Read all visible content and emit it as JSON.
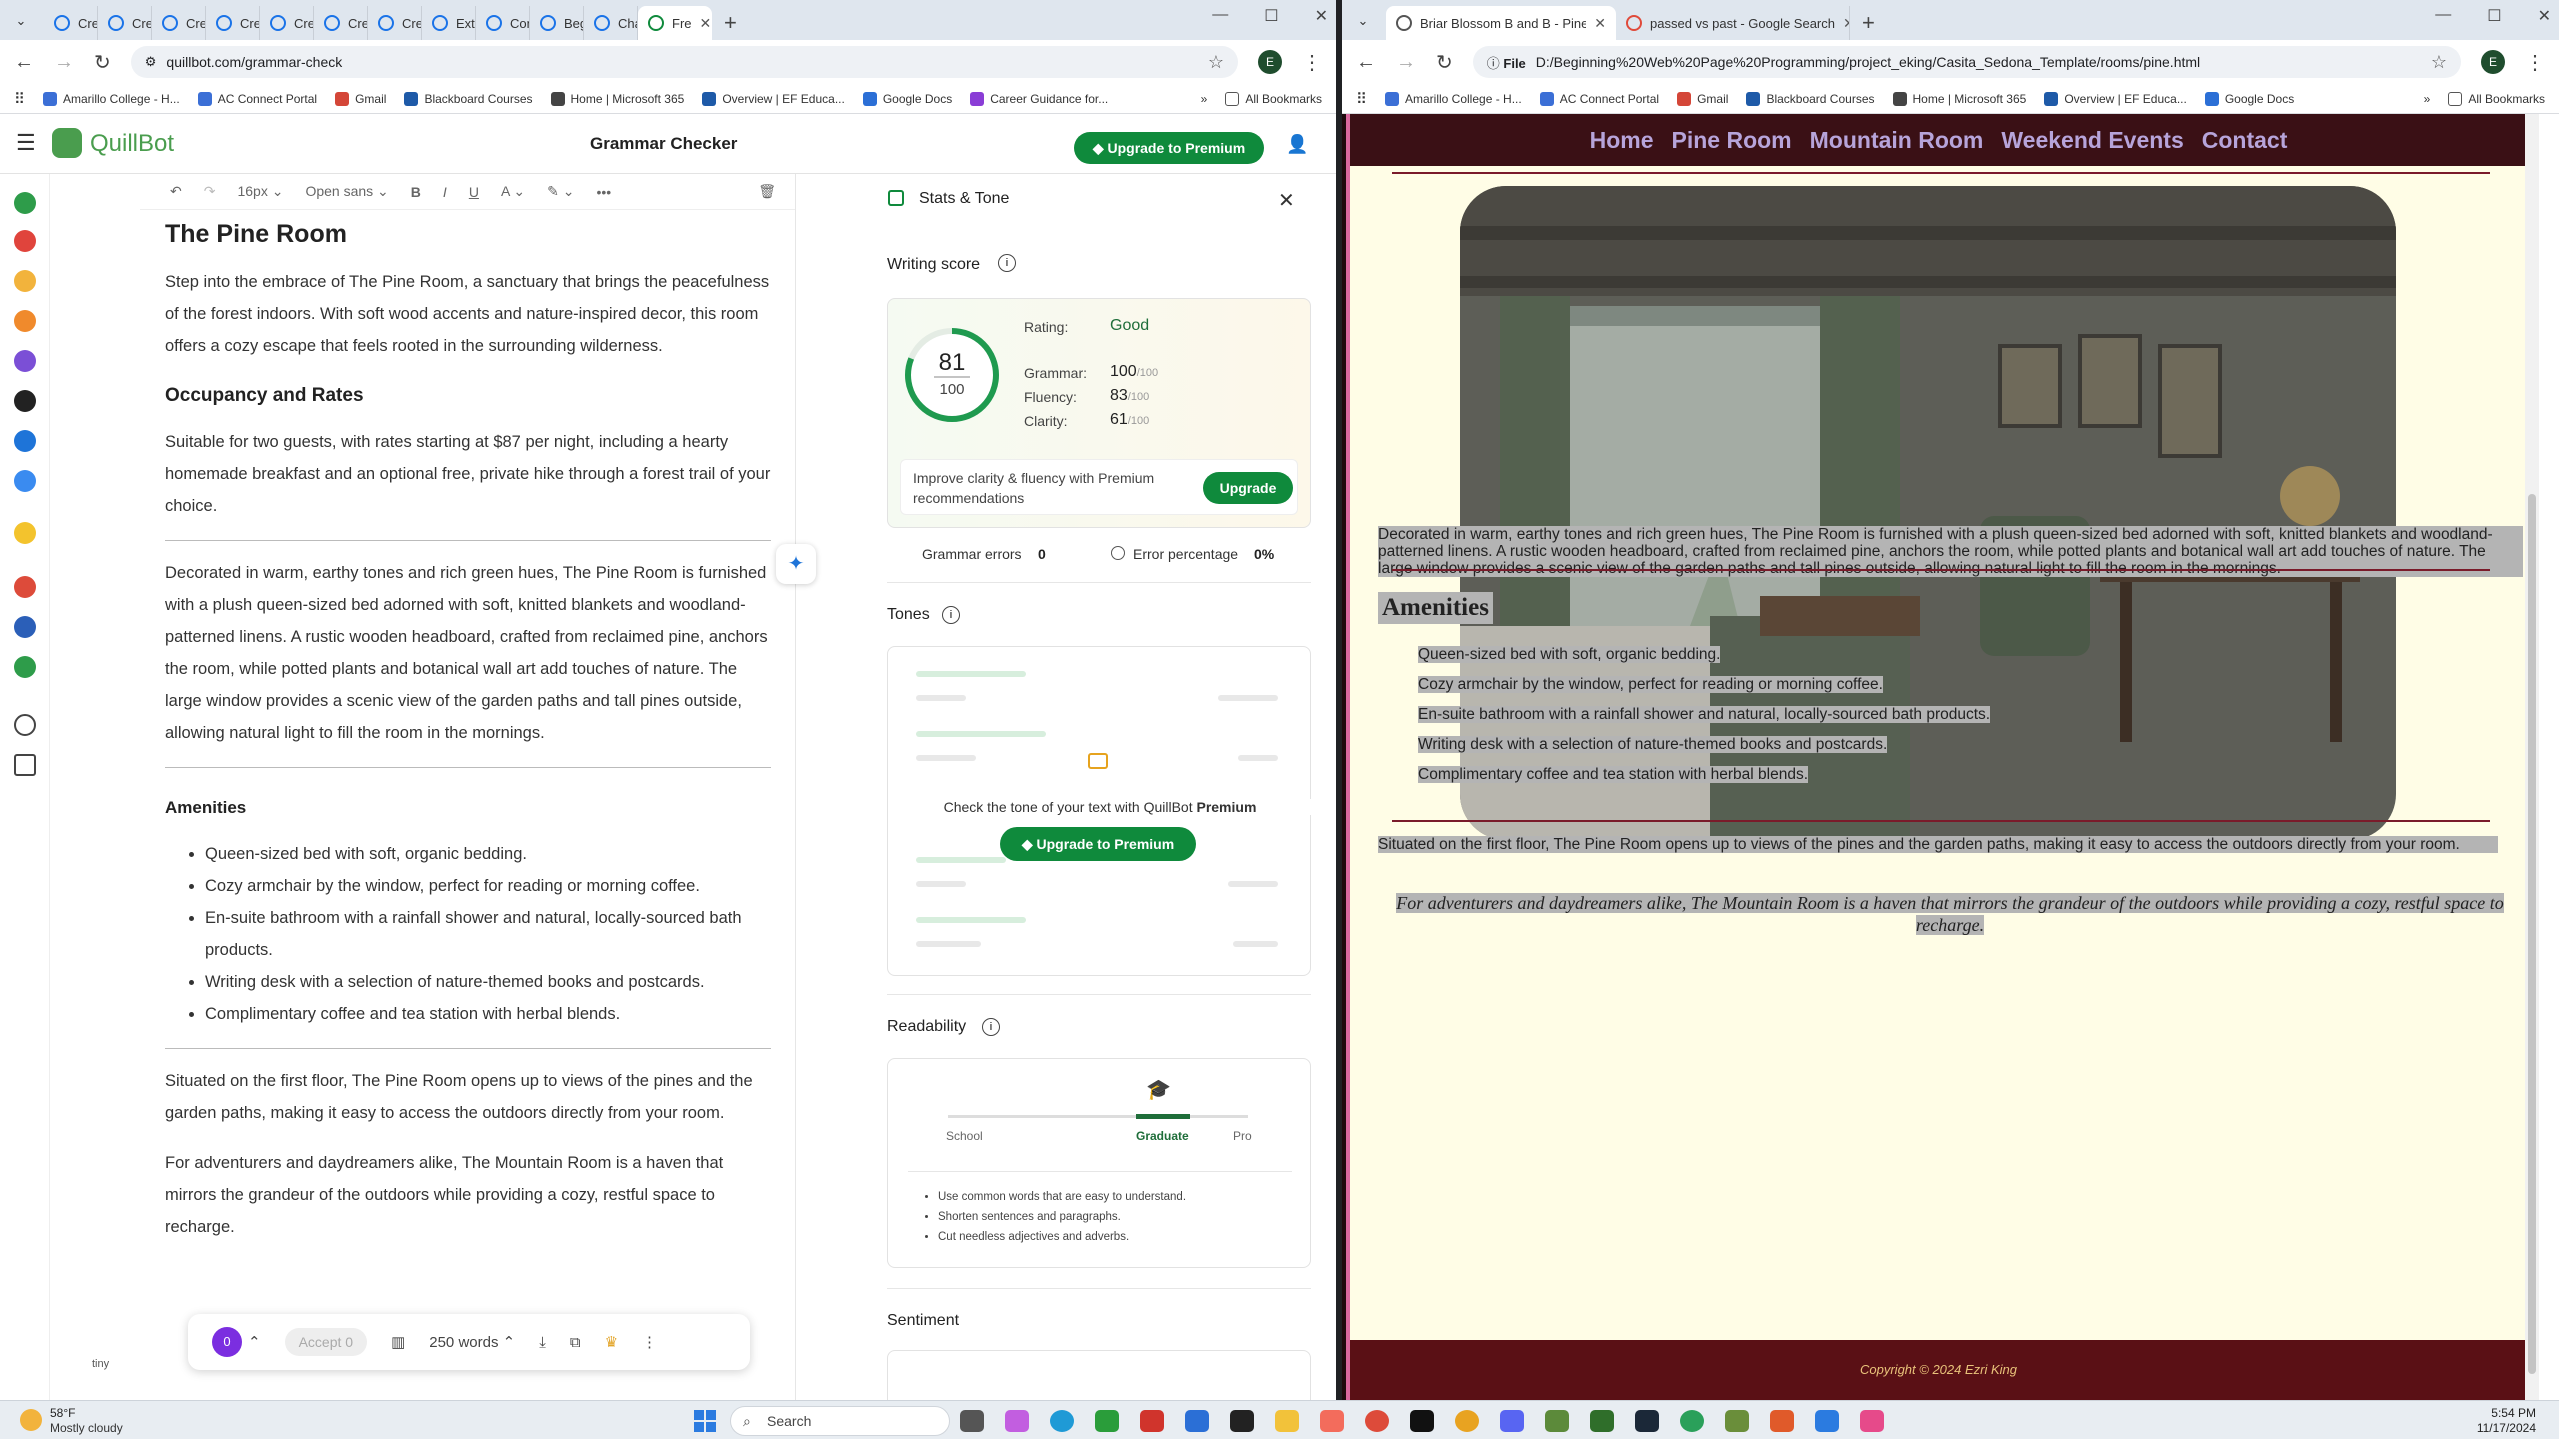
{
  "left_browser": {
    "tabs": [
      {
        "label": "Cre"
      },
      {
        "label": "Cre"
      },
      {
        "label": "Cre"
      },
      {
        "label": "Cre"
      },
      {
        "label": "Cre"
      },
      {
        "label": "Cre"
      },
      {
        "label": "Cre"
      },
      {
        "label": "Extract"
      },
      {
        "label": "Content"
      },
      {
        "label": "Beginni"
      },
      {
        "label": "Chapte"
      },
      {
        "label": "Fre",
        "active": true
      }
    ],
    "url": "quillbot.com/grammar-check",
    "profile_initial": "E",
    "bookmarks": [
      "Amarillo College - H...",
      "AC Connect Portal",
      "Gmail",
      "Blackboard Courses",
      "Home | Microsoft 365",
      "Overview | EF Educa...",
      "Google Docs",
      "Career Guidance for..."
    ],
    "all_bookmarks": "All Bookmarks"
  },
  "right_browser": {
    "tabs": [
      {
        "label": "Briar Blossom B and B - Pine Ro",
        "active": true
      },
      {
        "label": "passed vs past - Google Search"
      }
    ],
    "url_scheme": "File",
    "url": "D:/Beginning%20Web%20Page%20Programming/project_eking/Casita_Sedona_Template/rooms/pine.html",
    "profile_initial": "E",
    "bookmarks": [
      "Amarillo College - H...",
      "AC Connect Portal",
      "Gmail",
      "Blackboard Courses",
      "Home | Microsoft 365",
      "Overview | EF Educa...",
      "Google Docs"
    ],
    "all_bookmarks": "All Bookmarks"
  },
  "quillbot": {
    "logo": "QuillBot",
    "page_title": "Grammar Checker",
    "upgrade_label": "Upgrade to Premium",
    "toolbar": {
      "size": "16px",
      "font": "Open sans"
    },
    "doc": {
      "title": "The Pine Room",
      "intro": "Step into the embrace of The Pine Room, a sanctuary that brings the peacefulness of the forest indoors. With soft wood accents and nature-inspired decor, this room offers a cozy escape that feels rooted in the surrounding wilderness.",
      "occupancy_heading": "Occupancy and Rates",
      "occupancy_text": "Suitable for two guests, with rates starting at $87 per night, including a hearty homemade breakfast and an optional free, private hike through a forest trail of your choice.",
      "description": "Decorated in warm, earthy tones and rich green hues, The Pine Room is furnished with a plush queen-sized bed adorned with soft, knitted blankets and woodland-patterned linens. A rustic wooden headboard, crafted from reclaimed pine, anchors the room, while potted plants and botanical wall art add touches of nature. The large window provides a scenic view of the garden paths and tall pines outside, allowing natural light to fill the room in the mornings.",
      "amenities_heading": "Amenities",
      "amenities": [
        "Queen-sized bed with soft, organic bedding.",
        "Cozy armchair by the window, perfect for reading or morning coffee.",
        "En-suite bathroom with a rainfall shower and natural, locally-sourced bath products.",
        "Writing desk with a selection of nature-themed books and postcards.",
        "Complimentary coffee and tea station with herbal blends."
      ],
      "situated": "Situated on the first floor, The Pine Room opens up to views of the pines and the garden paths, making it easy to access the outdoors directly from your room.",
      "closing": "For adventurers and daydreamers alike, The Mountain Room is a haven that mirrors the grandeur of the outdoors while providing a cozy, restful space to recharge."
    },
    "bottom": {
      "count": "0",
      "accept": "Accept 0",
      "words": "250 words",
      "tiny": "tiny"
    },
    "stats": {
      "header": "Stats & Tone",
      "writing_score_label": "Writing score",
      "score": "81",
      "score_max": "100",
      "score_fraction": 0.81,
      "rating_label": "Rating:",
      "rating": "Good",
      "grammar_label": "Grammar:",
      "grammar": "100",
      "grammar_max": "/100",
      "fluency_label": "Fluency:",
      "fluency": "83",
      "fluency_max": "/100",
      "clarity_label": "Clarity:",
      "clarity": "61",
      "clarity_max": "/100",
      "improve_text": "Improve clarity & fluency with Premium recommendations",
      "upgrade": "Upgrade",
      "grammar_errors_label": "Grammar errors",
      "grammar_errors": "0",
      "error_pct_label": "Error percentage",
      "error_pct": "0%",
      "tones_label": "Tones",
      "tones_lock_text": "Check the tone of your text with QuillBot",
      "tones_lock_premium": "Premium",
      "tones_upgrade": "Upgrade to Premium",
      "readability_label": "Readability",
      "readability_levels": [
        "School",
        "Graduate",
        "Pro"
      ],
      "readability_tips": [
        "Use common words that are easy to understand.",
        "Shorten sentences and paragraphs.",
        "Cut needless adjectives and adverbs."
      ],
      "sentiment_label": "Sentiment"
    }
  },
  "site": {
    "nav": [
      "Home",
      "Pine Room",
      "Mountain Room",
      "Weekend Events",
      "Contact"
    ],
    "description": "Decorated in warm, earthy tones and rich green hues, The Pine Room is furnished with a plush queen-sized bed adorned with soft, knitted blankets and woodland-patterned linens. A rustic wooden headboard, crafted from reclaimed pine, anchors the room, while potted plants and botanical wall art add touches of nature. The large window provides a scenic view of the garden paths and tall pines outside, allowing natural light to fill the room in the mornings.",
    "amenities_heading": "Amenities",
    "amenities": [
      "Queen-sized bed with soft, organic bedding.",
      "Cozy armchair by the window, perfect for reading or morning coffee.",
      "En-suite bathroom with a rainfall shower and natural, locally-sourced bath products.",
      "Writing desk with a selection of nature-themed books and postcards.",
      "Complimentary coffee and tea station with herbal blends."
    ],
    "situated": "Situated on the first floor, The Pine Room opens up to views of the pines and the garden paths, making it easy to access the outdoors directly from your room.",
    "closing": "For adventurers and daydreamers alike, The Mountain Room is a haven that mirrors the grandeur of the outdoors while providing a cozy, restful space to recharge.",
    "footer": "Copyright © 2024 Ezri King"
  },
  "taskbar": {
    "temp": "58°F",
    "weather": "Mostly cloudy",
    "search": "Search",
    "time": "5:54 PM",
    "date": "11/17/2024"
  },
  "colors": {
    "quillbot_green": "#0f8a3c",
    "site_bg": "#fffde6",
    "site_nav": "#3a1015",
    "site_link": "#b7a4da"
  }
}
